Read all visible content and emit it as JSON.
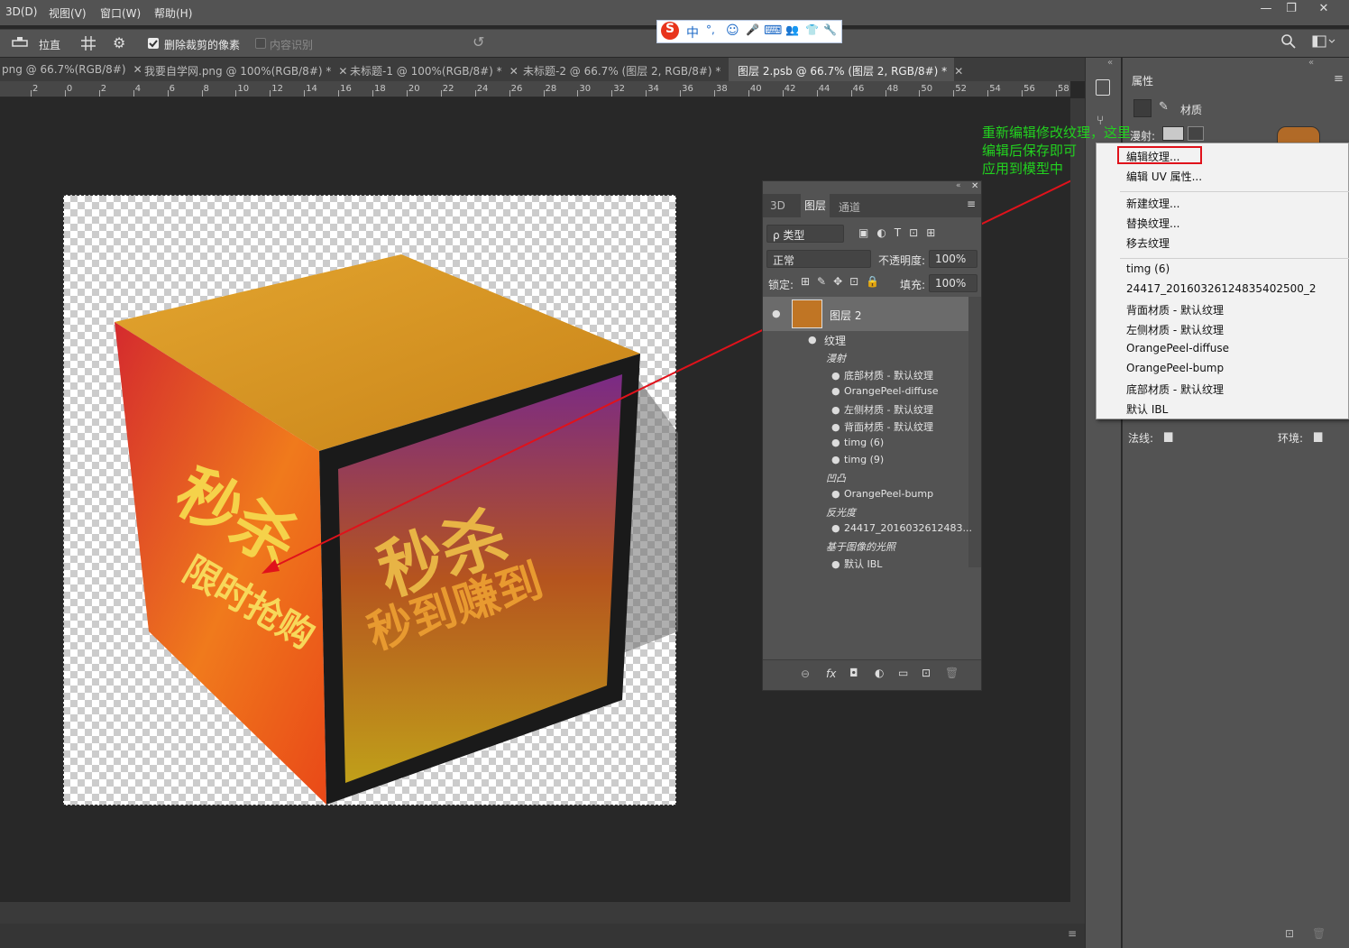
{
  "menu": [
    "3D(D)",
    "视图(V)",
    "窗口(W)",
    "帮助(H)"
  ],
  "window_buttons": [
    "—",
    "❐",
    "✕"
  ],
  "ime": {
    "glyphs": [
      "S",
      "中",
      "°,",
      "☺",
      "🎤",
      "⌨",
      "👥",
      "👕",
      "🔧"
    ]
  },
  "options": {
    "straighten_label": "拉直",
    "delete_cropped_label": "删除裁剪的像素",
    "content_aware_label": "内容识别"
  },
  "tabs": [
    {
      "label": "png @ 66.7%(RGB/8#)",
      "close": "✕",
      "active": false
    },
    {
      "label": "我要自学网.png @ 100%(RGB/8#) *",
      "close": "✕",
      "active": false
    },
    {
      "label": "未标题-1 @ 100%(RGB/8#) *",
      "close": "✕",
      "active": false
    },
    {
      "label": "未标题-2 @ 66.7% (图层 2, RGB/8#) *",
      "close": "✕",
      "active": false
    },
    {
      "label": "图层 2.psb @ 66.7% (图层 2, RGB/8#) *",
      "close": "✕",
      "active": true
    }
  ],
  "ruler_ticks": [
    "2",
    "0",
    "2",
    "4",
    "6",
    "8",
    "10",
    "12",
    "14",
    "16",
    "18",
    "20",
    "22",
    "24",
    "26",
    "28",
    "30",
    "32",
    "34",
    "36",
    "38",
    "40",
    "42",
    "44",
    "46",
    "48",
    "50",
    "52",
    "54",
    "56",
    "58"
  ],
  "layers_panel": {
    "tabs": [
      "3D",
      "图层",
      "通道"
    ],
    "filter": "ρ 类型",
    "blend_mode": "正常",
    "opacity_label": "不透明度:",
    "opacity_value": "100%",
    "lock_label": "锁定:",
    "fill_label": "填充:",
    "fill_value": "100%",
    "layer_name": "图层 2",
    "textures_label": "纹理",
    "groups": [
      {
        "name": "漫射",
        "items": [
          "底部材质 - 默认纹理",
          "OrangePeel-diffuse",
          "左侧材质 - 默认纹理",
          "背面材质 - 默认纹理",
          "timg (6)",
          "timg (9)"
        ]
      },
      {
        "name": "凹凸",
        "items": [
          "OrangePeel-bump"
        ]
      },
      {
        "name": "反光度",
        "items": [
          "24417_2016032612483..."
        ]
      },
      {
        "name": "基于图像的光照",
        "items": [
          "默认 IBL"
        ]
      }
    ],
    "footer_icons": [
      "link-icon",
      "fx-icon",
      "mask-icon",
      "adjustment-icon",
      "folder-icon",
      "new-layer-icon",
      "trash-icon"
    ],
    "footer_glyphs": [
      "⊖",
      "fx",
      "◘",
      "◐",
      "▭",
      "⊡",
      "🗑"
    ]
  },
  "properties_panel": {
    "title": "属性",
    "material_label": "材质",
    "diffuse_label": "漫射:",
    "normal_label": "法线:",
    "environment_label": "环境:"
  },
  "context_menu": {
    "items_1": [
      "编辑纹理...",
      "编辑 UV 属性..."
    ],
    "items_2": [
      "新建纹理...",
      "替换纹理...",
      "移去纹理"
    ],
    "items_3": [
      "timg (6)",
      "24417_20160326124835402500_2",
      "背面材质 - 默认纹理",
      "左侧材质 - 默认纹理",
      "OrangePeel-diffuse",
      "OrangePeel-bump",
      "底部材质 - 默认纹理",
      "默认 IBL"
    ]
  },
  "annotation": "重新编辑修改纹理，这里\n编辑后保存即可\n应用到模型中",
  "colors": {
    "annotation": "#22d11f",
    "arrow": "#e0121b",
    "panel": "#535353",
    "canvas": "#282828"
  }
}
